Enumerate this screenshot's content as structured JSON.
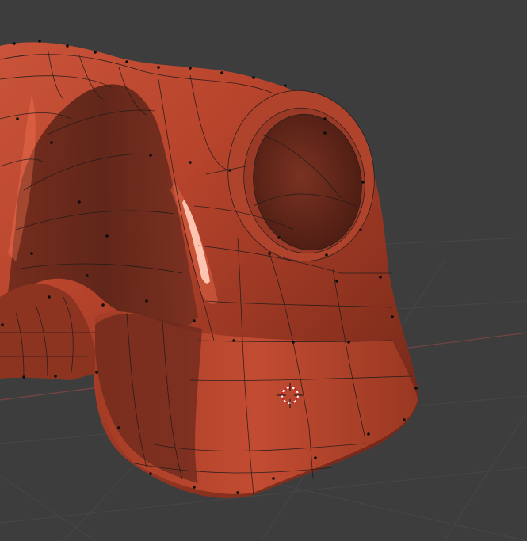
{
  "viewport": {
    "background_color": "#3d3d3d",
    "grid_line_color": "#474747",
    "axis_x_color": "#8a4a4a",
    "object": {
      "base_color": "#b8442c",
      "highlight_color": "#e06a48",
      "shadow_color": "#5a2418",
      "wire_color": "#1a1a1a",
      "vertex_color": "#0d0d0d"
    },
    "cursor_icon": "3d-cursor-icon"
  }
}
